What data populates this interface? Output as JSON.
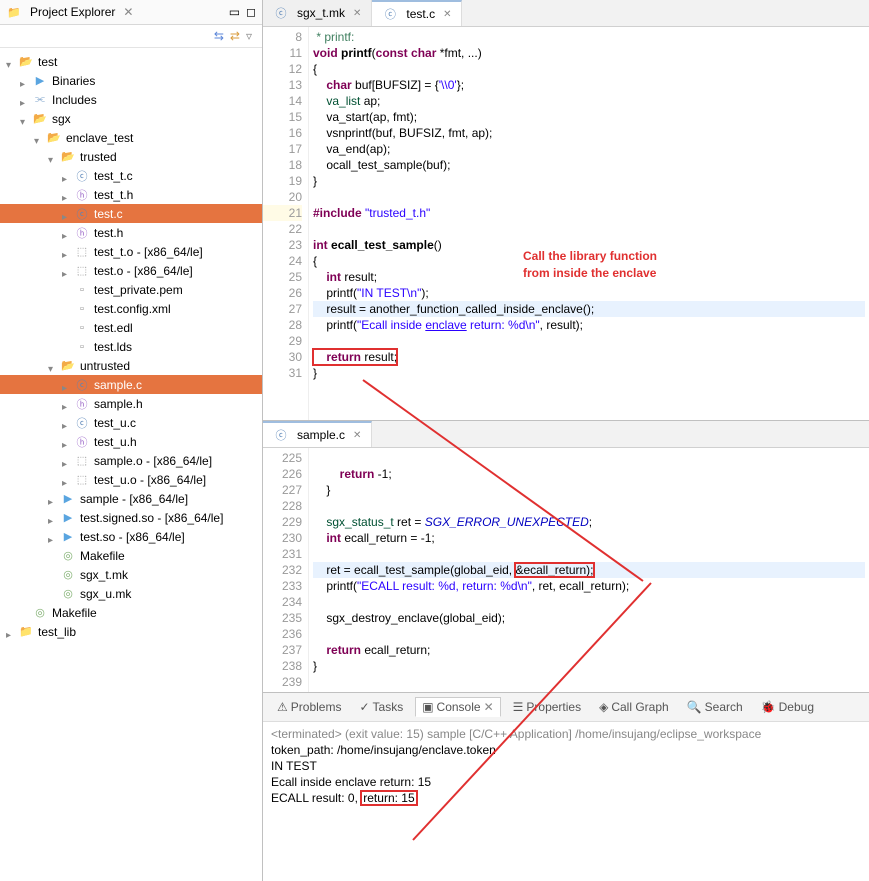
{
  "explorer": {
    "title": "Project Explorer",
    "tree": [
      {
        "depth": 0,
        "tw": "open",
        "icon": "folder-open",
        "label": "test"
      },
      {
        "depth": 1,
        "tw": "closed",
        "icon": "bin",
        "label": "Binaries"
      },
      {
        "depth": 1,
        "tw": "closed",
        "icon": "inc",
        "label": "Includes"
      },
      {
        "depth": 1,
        "tw": "open",
        "icon": "folder-open",
        "label": "sgx"
      },
      {
        "depth": 2,
        "tw": "open",
        "icon": "folder-open",
        "label": "enclave_test"
      },
      {
        "depth": 3,
        "tw": "open",
        "icon": "folder-open",
        "label": "trusted"
      },
      {
        "depth": 4,
        "tw": "closed",
        "icon": "cfile",
        "label": "test_t.c"
      },
      {
        "depth": 4,
        "tw": "closed",
        "icon": "hfile",
        "label": "test_t.h"
      },
      {
        "depth": 4,
        "tw": "closed",
        "icon": "cfile",
        "label": "test.c",
        "selected": true
      },
      {
        "depth": 4,
        "tw": "closed",
        "icon": "hfile",
        "label": "test.h"
      },
      {
        "depth": 4,
        "tw": "closed",
        "icon": "ofile",
        "label": "test_t.o - [x86_64/le]"
      },
      {
        "depth": 4,
        "tw": "closed",
        "icon": "ofile",
        "label": "test.o - [x86_64/le]"
      },
      {
        "depth": 4,
        "tw": "none",
        "icon": "gen",
        "label": "test_private.pem"
      },
      {
        "depth": 4,
        "tw": "none",
        "icon": "gen",
        "label": "test.config.xml"
      },
      {
        "depth": 4,
        "tw": "none",
        "icon": "gen",
        "label": "test.edl"
      },
      {
        "depth": 4,
        "tw": "none",
        "icon": "gen",
        "label": "test.lds"
      },
      {
        "depth": 3,
        "tw": "open",
        "icon": "folder-open",
        "label": "untrusted"
      },
      {
        "depth": 4,
        "tw": "closed",
        "icon": "cfile",
        "label": "sample.c",
        "selected": true
      },
      {
        "depth": 4,
        "tw": "closed",
        "icon": "hfile",
        "label": "sample.h"
      },
      {
        "depth": 4,
        "tw": "closed",
        "icon": "cfile",
        "label": "test_u.c"
      },
      {
        "depth": 4,
        "tw": "closed",
        "icon": "hfile",
        "label": "test_u.h"
      },
      {
        "depth": 4,
        "tw": "closed",
        "icon": "ofile",
        "label": "sample.o - [x86_64/le]"
      },
      {
        "depth": 4,
        "tw": "closed",
        "icon": "ofile",
        "label": "test_u.o - [x86_64/le]"
      },
      {
        "depth": 3,
        "tw": "closed",
        "icon": "bin",
        "label": "sample - [x86_64/le]"
      },
      {
        "depth": 3,
        "tw": "closed",
        "icon": "bin",
        "label": "test.signed.so - [x86_64/le]"
      },
      {
        "depth": 3,
        "tw": "closed",
        "icon": "bin",
        "label": "test.so - [x86_64/le]"
      },
      {
        "depth": 3,
        "tw": "none",
        "icon": "make",
        "label": "Makefile"
      },
      {
        "depth": 3,
        "tw": "none",
        "icon": "make",
        "label": "sgx_t.mk"
      },
      {
        "depth": 3,
        "tw": "none",
        "icon": "make",
        "label": "sgx_u.mk"
      },
      {
        "depth": 1,
        "tw": "none",
        "icon": "make",
        "label": "Makefile"
      },
      {
        "depth": 0,
        "tw": "closed",
        "icon": "folder",
        "label": "test_lib"
      }
    ]
  },
  "editor_top": {
    "tabs": [
      {
        "label": "sgx_t.mk",
        "active": false
      },
      {
        "label": "test.c",
        "active": true
      }
    ],
    "lines": [
      {
        "n": 8,
        "html": "<span class='com'> * printf: </span>"
      },
      {
        "n": 11,
        "html": "<span class='kw'>void</span> <b>printf</b>(<span class='kw'>const</span> <span class='kw'>char</span> *fmt, ...)"
      },
      {
        "n": 12,
        "html": "{"
      },
      {
        "n": 13,
        "html": "    <span class='kw'>char</span> buf[BUFSIZ] = {<span class='char'>'\\\\0'</span>};"
      },
      {
        "n": 14,
        "html": "    <span class='type'>va_list</span> ap;"
      },
      {
        "n": 15,
        "html": "    va_start(ap, fmt);"
      },
      {
        "n": 16,
        "html": "    vsnprintf(buf, BUFSIZ, fmt, ap);"
      },
      {
        "n": 17,
        "html": "    va_end(ap);"
      },
      {
        "n": 18,
        "html": "    ocall_test_sample(buf);"
      },
      {
        "n": 19,
        "html": "}"
      },
      {
        "n": 20,
        "html": ""
      },
      {
        "n": 21,
        "html": "<span class='pp'>#include</span> <span class='inc'>\"trusted_t.h\"</span>",
        "warn": true
      },
      {
        "n": 22,
        "html": ""
      },
      {
        "n": 23,
        "html": "<span class='kw'>int</span> <b>ecall_test_sample</b>()"
      },
      {
        "n": 24,
        "html": "{"
      },
      {
        "n": 25,
        "html": "    <span class='kw'>int</span> result;"
      },
      {
        "n": 26,
        "html": "    printf(<span class='str'>\"IN TEST\\n\"</span>);"
      },
      {
        "n": 27,
        "html": "    result = another_function_called_inside_enclave();",
        "hl": true
      },
      {
        "n": 28,
        "html": "    printf(<span class='str'>\"Ecall inside <u>enclave</u> return: %d\\n\"</span>, result);"
      },
      {
        "n": 29,
        "html": ""
      },
      {
        "n": 30,
        "html": "    <span class='kw'>return</span> result;",
        "redbox": true
      },
      {
        "n": 31,
        "html": "}"
      }
    ]
  },
  "editor_mid": {
    "tabs": [
      {
        "label": "sample.c",
        "active": true
      }
    ],
    "lines": [
      {
        "n": 225,
        "html": ""
      },
      {
        "n": 226,
        "html": "        <span class='kw'>return</span> -1;"
      },
      {
        "n": 227,
        "html": "    }"
      },
      {
        "n": 228,
        "html": ""
      },
      {
        "n": 229,
        "html": "    <span class='type'>sgx_status_t</span> ret = <i style='color:#0000c0'>SGX_ERROR_UNEXPECTED</i>;"
      },
      {
        "n": 230,
        "html": "    <span class='kw'>int</span> ecall_return = -1;"
      },
      {
        "n": 231,
        "html": ""
      },
      {
        "n": 232,
        "html": "    ret = ecall_test_sample(global_eid, <span class='redbox'>&ecall_return);</span>",
        "hl": true
      },
      {
        "n": 233,
        "html": "    printf(<span class='str'>\"ECALL result: %d, return: %d\\n\"</span>, ret, ecall_return);"
      },
      {
        "n": 234,
        "html": ""
      },
      {
        "n": 235,
        "html": "    sgx_destroy_enclave(global_eid);"
      },
      {
        "n": 236,
        "html": ""
      },
      {
        "n": 237,
        "html": "    <span class='kw'>return</span> ecall_return;"
      },
      {
        "n": 238,
        "html": "}"
      },
      {
        "n": 239,
        "html": ""
      }
    ]
  },
  "console": {
    "tabs": [
      "Problems",
      "Tasks",
      "Console",
      "Properties",
      "Call Graph",
      "Search",
      "Debug"
    ],
    "active_tab": "Console",
    "header": "<terminated> (exit value: 15) sample [C/C++ Application] /home/insujang/eclipse_workspace",
    "lines": [
      "token_path: /home/insujang/enclave.token",
      "IN TEST",
      "Ecall inside enclave return: 15",
      "ECALL result: 0, return: 15"
    ],
    "highlight_line3": "return: 15",
    "highlight_line4": "return: 15"
  },
  "annotation": {
    "line1": "Call the library function",
    "line2": "from inside the enclave"
  }
}
